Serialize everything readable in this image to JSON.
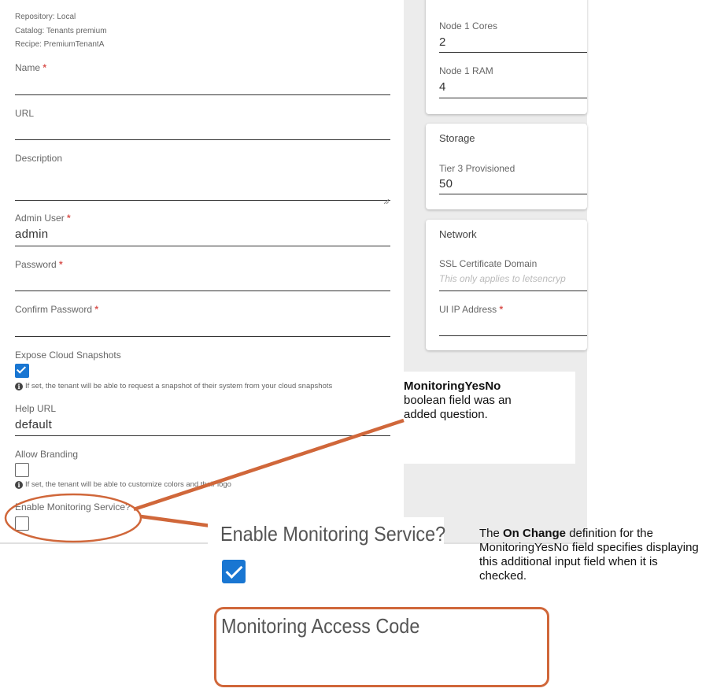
{
  "meta": {
    "repository": "Repository: Local",
    "catalog": "Catalog: Tenants premium",
    "recipe": "Recipe: PremiumTenantA"
  },
  "form": {
    "name_label": "Name",
    "url_label": "URL",
    "description_label": "Description",
    "admin_user_label": "Admin User",
    "admin_user_value": "admin",
    "password_label": "Password",
    "confirm_password_label": "Confirm Password",
    "expose_snapshots_label": "Expose Cloud Snapshots",
    "expose_snapshots_checked": true,
    "expose_snapshots_help": "If set, the tenant will be able to request a snapshot of their system from your cloud snapshots",
    "help_url_label": "Help URL",
    "help_url_value": "default",
    "allow_branding_label": "Allow Branding",
    "allow_branding_checked": false,
    "allow_branding_help": "If set, the tenant will be able to customize colors and their logo",
    "monitoring_label": "Enable Monitoring Service?",
    "monitoring_checked": false,
    "required_marker": "*"
  },
  "right_panel": {
    "compute": {
      "node1_cores_label": "Node 1 Cores",
      "node1_cores_value": "2",
      "node1_ram_label": "Node 1 RAM",
      "node1_ram_value": "4"
    },
    "storage": {
      "title": "Storage",
      "tier3_label": "Tier 3 Provisioned",
      "tier3_value": "50"
    },
    "network": {
      "title": "Network",
      "ssl_label": "SSL Certificate Domain",
      "ssl_placeholder": "This only applies to letsencryp",
      "ui_ip_label": "UI IP Address"
    }
  },
  "annotations": {
    "box_title": "MonitoringYesNo",
    "box_body": "boolean field was an added question.",
    "zoom_label": "Enable Monitoring Service?",
    "zoom_checked": true,
    "zoom_field_label": "Monitoring Access Code",
    "note_prefix": "The ",
    "note_bold": "On Change",
    "note_suffix": " definition for the MonitoringYesNo field specifies displaying this additional input field when it is checked."
  },
  "colors": {
    "accent": "#1976d2",
    "annotation": "#d0673a",
    "required": "#d9534f"
  }
}
